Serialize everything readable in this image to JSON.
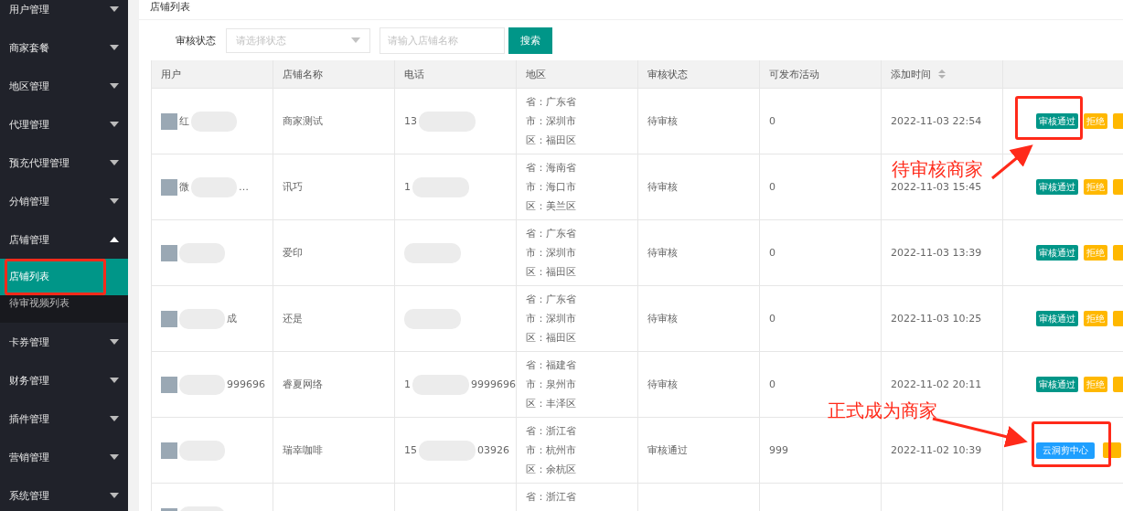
{
  "sidebar": {
    "items": [
      {
        "label": "用户管理",
        "expanded": false
      },
      {
        "label": "商家套餐",
        "expanded": false
      },
      {
        "label": "地区管理",
        "expanded": false
      },
      {
        "label": "代理管理",
        "expanded": false
      },
      {
        "label": "预充代理管理",
        "expanded": false
      },
      {
        "label": "分销管理",
        "expanded": false
      },
      {
        "label": "店铺管理",
        "expanded": true,
        "children": [
          {
            "label": "店铺列表",
            "selected": true
          },
          {
            "label": "待审视频列表",
            "selected": false
          }
        ]
      },
      {
        "label": "卡券管理",
        "expanded": false
      },
      {
        "label": "财务管理",
        "expanded": false
      },
      {
        "label": "插件管理",
        "expanded": false
      },
      {
        "label": "营销管理",
        "expanded": false
      },
      {
        "label": "系统管理",
        "expanded": false
      }
    ]
  },
  "page_title": "店铺列表",
  "filter": {
    "label": "审核状态",
    "status_select": {
      "placeholder": "请选择状态"
    },
    "name_field": {
      "placeholder": "请输入店铺名称"
    },
    "search_button": "搜索"
  },
  "table": {
    "columns": [
      "用户",
      "店铺名称",
      "电话",
      "地区",
      "审核状态",
      "可发布活动",
      "添加时间"
    ],
    "rows": [
      {
        "user_start": "红",
        "shop": "商家测试",
        "phone_start": "13",
        "region": [
          "省：广东省",
          "市：深圳市",
          "区：福田区"
        ],
        "status": "待审核",
        "activities": "0",
        "time": "2022-11-03 22:54",
        "actions": [
          {
            "kind": "approve",
            "label": "审核通过"
          },
          {
            "kind": "reject",
            "label": "拒绝"
          },
          {
            "kind": "reject"
          }
        ]
      },
      {
        "user_start": "微",
        "user_end": "…",
        "shop": "讯巧",
        "phone_start": "1",
        "region": [
          "省：海南省",
          "市：海口市",
          "区：美兰区"
        ],
        "status": "待审核",
        "activities": "0",
        "time": "2022-11-03 15:45",
        "actions": [
          {
            "kind": "approve",
            "label": "审核通过"
          },
          {
            "kind": "reject",
            "label": "拒绝"
          },
          {
            "kind": "reject"
          }
        ]
      },
      {
        "shop": "爱印",
        "region": [
          "省：广东省",
          "市：深圳市",
          "区：福田区"
        ],
        "status": "待审核",
        "activities": "0",
        "time": "2022-11-03 13:39",
        "actions": [
          {
            "kind": "approve",
            "label": "审核通过"
          },
          {
            "kind": "reject",
            "label": "拒绝"
          },
          {
            "kind": "reject"
          }
        ]
      },
      {
        "user_end": "成",
        "shop": "还是",
        "region": [
          "省：广东省",
          "市：深圳市",
          "区：福田区"
        ],
        "status": "待审核",
        "activities": "0",
        "time": "2022-11-03 10:25",
        "actions": [
          {
            "kind": "approve",
            "label": "审核通过"
          },
          {
            "kind": "reject",
            "label": "拒绝"
          },
          {
            "kind": "reject"
          }
        ]
      },
      {
        "user_end": "999696",
        "shop": "睿夏网络",
        "phone_start": "1",
        "phone_end": "9999696",
        "region": [
          "省：福建省",
          "市：泉州市",
          "区：丰泽区"
        ],
        "status": "待审核",
        "activities": "0",
        "time": "2022-11-02 20:11",
        "actions": [
          {
            "kind": "approve",
            "label": "审核通过"
          },
          {
            "kind": "reject",
            "label": "拒绝"
          },
          {
            "kind": "reject"
          }
        ]
      },
      {
        "shop": "瑞幸咖啡",
        "phone_start": "15",
        "phone_end": "03926",
        "region": [
          "省：浙江省",
          "市：杭州市",
          "区：余杭区"
        ],
        "status": "审核通过",
        "activities": "999",
        "time": "2022-11-02 10:39",
        "actions": [
          {
            "kind": "center",
            "label": "云洞剪中心"
          },
          {
            "kind": "reject"
          }
        ]
      },
      {
        "region": [
          "省：浙江省"
        ]
      }
    ]
  },
  "annotations": [
    {
      "text": "待审核商家"
    },
    {
      "text": "正式成为商家"
    }
  ]
}
